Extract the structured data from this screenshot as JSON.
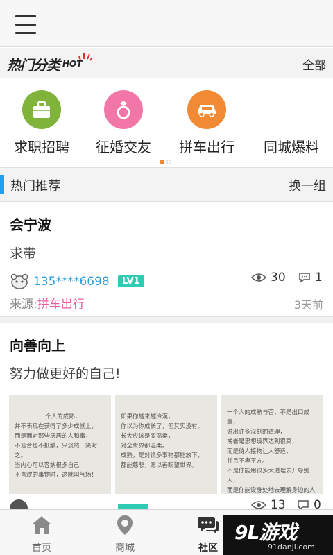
{
  "categories": {
    "title": "热门分类",
    "hot_badge": "HOT",
    "all_label": "全部",
    "items": [
      {
        "label": "求职招聘",
        "color": "#7fb33a",
        "icon": "briefcase-icon"
      },
      {
        "label": "征婚交友",
        "color": "#f277a8",
        "icon": "ring-icon"
      },
      {
        "label": "拼车出行",
        "color": "#f08a34",
        "icon": "car-icon"
      },
      {
        "label": "同城爆料",
        "color": "#4aa8e0",
        "icon": "megaphone-icon"
      }
    ],
    "page_dots": {
      "count": 2,
      "active": 0,
      "active_color": "#f08a34"
    }
  },
  "recommend": {
    "title": "热门推荐",
    "change_label": "换一组"
  },
  "posts": [
    {
      "title": "会宁波",
      "body": "求带",
      "user": "135****6698",
      "level": "LV1",
      "views": "30",
      "comments": "1",
      "source_label": "来源:",
      "source_link": "拼车出行",
      "time": "3天前"
    },
    {
      "title": "向善向上",
      "body": "努力做更好的自己!",
      "views": "13",
      "comments": "0",
      "images": [
        [
          "一个人的成熟，",
          "并不表现在获得了多少成就上，",
          "而是面对那些厌恶的人和事，",
          "不迎合也不抵触，只淡然一笑对之。",
          "当内心可以容纳很多自己",
          "不喜欢的事物时，这就叫气场！"
        ],
        [
          "如果你越来越冷漠，",
          "你以为你成长了，但其实没有。",
          "长大应该是变温柔，",
          "对全世界都温柔。",
          "成熟，是对很多事物都能放下，",
          "都能慈悲，愿以善眼望世界。"
        ],
        [
          "一个人的成熟与否，不是出口成章，",
          "说出许多深刻的道理，",
          "或者是思想境界达到很高，",
          "而是待人接物让人舒适，",
          "并且不卑不亢。",
          "不是你能用很多大道理去开导别人，",
          "而是你能设身处地去理解身边的人和事。"
        ]
      ]
    }
  ],
  "tabbar": {
    "items": [
      {
        "label": "首页",
        "icon": "home-icon"
      },
      {
        "label": "商城",
        "icon": "location-pin-icon"
      },
      {
        "label": "社区",
        "icon": "chat-bubbles-icon",
        "active": true
      },
      {
        "label": "",
        "icon": "user-icon"
      }
    ]
  },
  "watermark": {
    "main": "9L游戏",
    "sub": "91danji.com"
  }
}
